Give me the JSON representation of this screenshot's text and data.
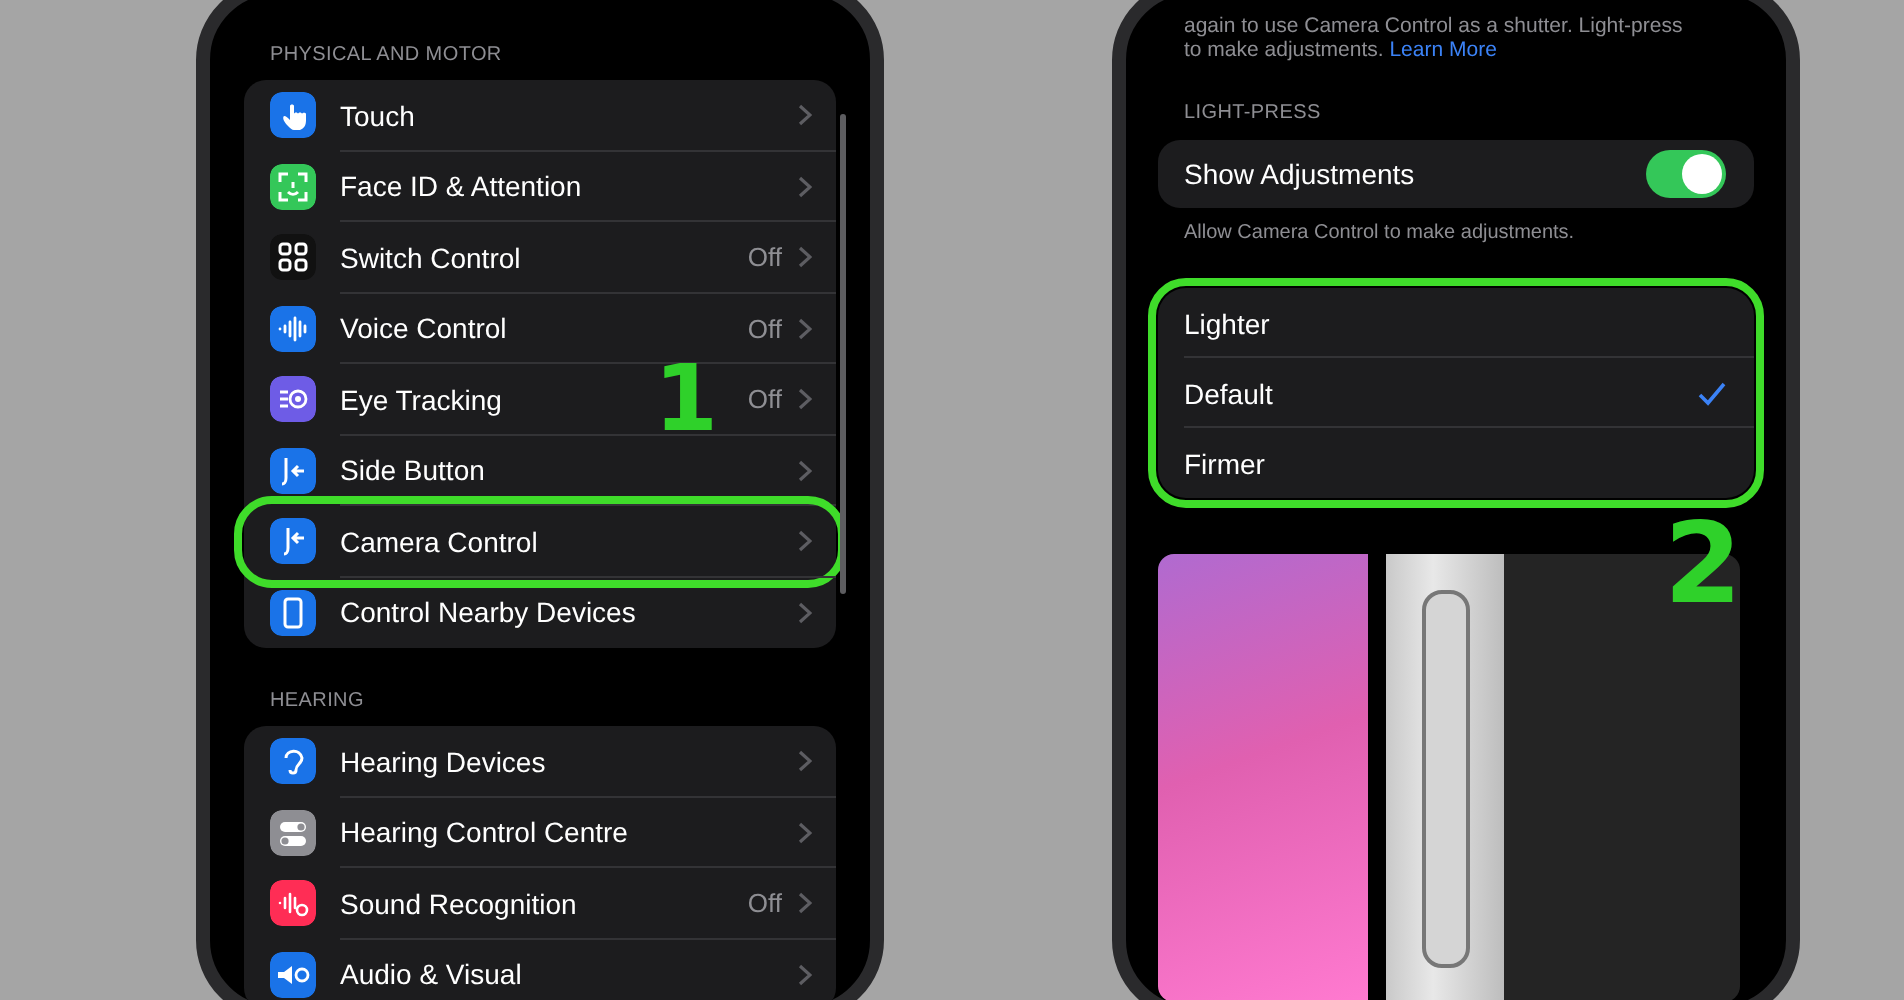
{
  "left_screen": {
    "sections": [
      {
        "header": "PHYSICAL AND MOTOR",
        "rows": [
          {
            "label": "Touch",
            "color": "#1a73e8",
            "highlighted": false
          },
          {
            "label": "Face ID & Attention",
            "color": "#34c759",
            "highlighted": false
          },
          {
            "label": "Switch Control",
            "value": "Off",
            "color": "#111111",
            "highlighted": false
          },
          {
            "label": "Voice Control",
            "value": "Off",
            "color": "#1a73e8",
            "highlighted": false
          },
          {
            "label": "Eye Tracking",
            "value": "Off",
            "color": "#6e5ce6",
            "highlighted": false,
            "annotation": "1"
          },
          {
            "label": "Side Button",
            "color": "#1a73e8",
            "highlighted": false
          },
          {
            "label": "Camera Control",
            "color": "#1a73e8",
            "highlighted": true
          },
          {
            "label": "Control Nearby Devices",
            "color": "#1a73e8",
            "highlighted": false
          }
        ]
      },
      {
        "header": "HEARING",
        "rows": [
          {
            "label": "Hearing Devices",
            "color": "#1a73e8",
            "highlighted": false
          },
          {
            "label": "Hearing Control Centre",
            "color": "#8e8e93",
            "highlighted": false
          },
          {
            "label": "Sound Recognition",
            "value": "Off",
            "color": "#ff2d55",
            "highlighted": false
          },
          {
            "label": "Audio & Visual",
            "color": "#1a73e8",
            "highlighted": false
          }
        ]
      }
    ]
  },
  "right_screen": {
    "annotation": "2",
    "description_lines": [
      "again to use Camera Control as a shutter. Light-press",
      "to make adjustments."
    ],
    "link": "Learn More",
    "header": "LIGHT-PRESS",
    "toggle": {
      "label": "Show Adjustments",
      "on": true
    },
    "toggle_footer": "Allow Camera Control to make adjustments.",
    "options_highlighted": true,
    "options": [
      {
        "label": "Lighter",
        "selected": false
      },
      {
        "label": "Default",
        "selected": true
      },
      {
        "label": "Firmer",
        "selected": false
      }
    ]
  }
}
